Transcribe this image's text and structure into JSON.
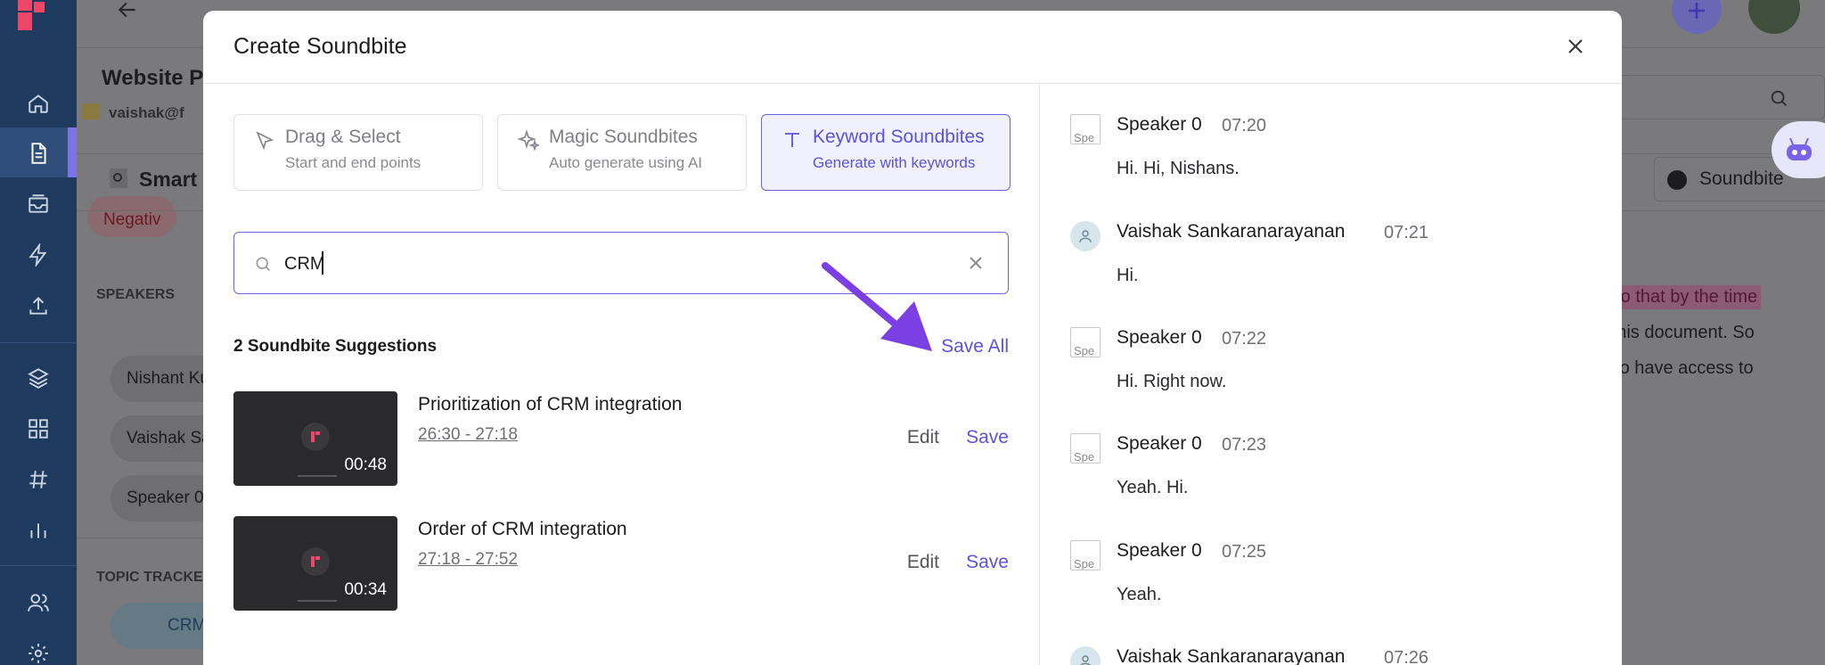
{
  "background": {
    "page_title": "Website Po",
    "user_email": "vaishak@f",
    "smart_label": "Smart S",
    "negative_tag": "Negativ",
    "speakers_heading": "SPEAKERS",
    "speakers": [
      "Nishant Ku",
      "Vaishak Sa",
      "Speaker 0"
    ],
    "topic_heading": "TOPIC TRACKE",
    "topic_tag": "CRM",
    "soundbite_button": "Soundbite",
    "doc_line1": "e so that by the time",
    "doc_line2": "h this document. So",
    "doc_line3": "also have access to"
  },
  "modal": {
    "title": "Create Soundbite",
    "tabs": [
      {
        "title": "Drag & Select",
        "subtitle": "Start and end points",
        "icon": "cursor-select-icon"
      },
      {
        "title": "Magic Soundbites",
        "subtitle": "Auto generate using AI",
        "icon": "sparkle-icon"
      },
      {
        "title": "Keyword Soundbites",
        "subtitle": "Generate with keywords",
        "icon": "text-t-icon"
      }
    ],
    "search": {
      "value": "CRM"
    },
    "suggestions_count": "2 Soundbite Suggestions",
    "save_all_label": "Save All",
    "items": [
      {
        "title": "Prioritization of CRM integration",
        "range": "26:30 - 27:18",
        "duration": "00:48",
        "edit": "Edit",
        "save": "Save"
      },
      {
        "title": "Order of CRM integration",
        "range": "27:18 - 27:52",
        "duration": "00:34",
        "edit": "Edit",
        "save": "Save"
      }
    ],
    "transcript": [
      {
        "speaker": "Speaker 0",
        "time": "07:20",
        "text": "Hi. Hi, Nishans.",
        "avatar": "broken",
        "alt": "Spe"
      },
      {
        "speaker": "Vaishak Sankaranarayanan",
        "time": "07:21",
        "text": "Hi.",
        "avatar": "person"
      },
      {
        "speaker": "Speaker 0",
        "time": "07:22",
        "text": "Hi. Right now.",
        "avatar": "broken",
        "alt": "Spe"
      },
      {
        "speaker": "Speaker 0",
        "time": "07:23",
        "text": "Yeah. Hi.",
        "avatar": "broken",
        "alt": "Spe"
      },
      {
        "speaker": "Speaker 0",
        "time": "07:25",
        "text": "Yeah.",
        "avatar": "broken",
        "alt": "Spe"
      },
      {
        "speaker": "Vaishak Sankaranarayanan",
        "time": "07:26",
        "text": "",
        "avatar": "person"
      }
    ]
  },
  "colors": {
    "accent": "#5b52e0",
    "sidebar": "#1f3a5f",
    "annotation_arrow": "#7b3fe4"
  }
}
